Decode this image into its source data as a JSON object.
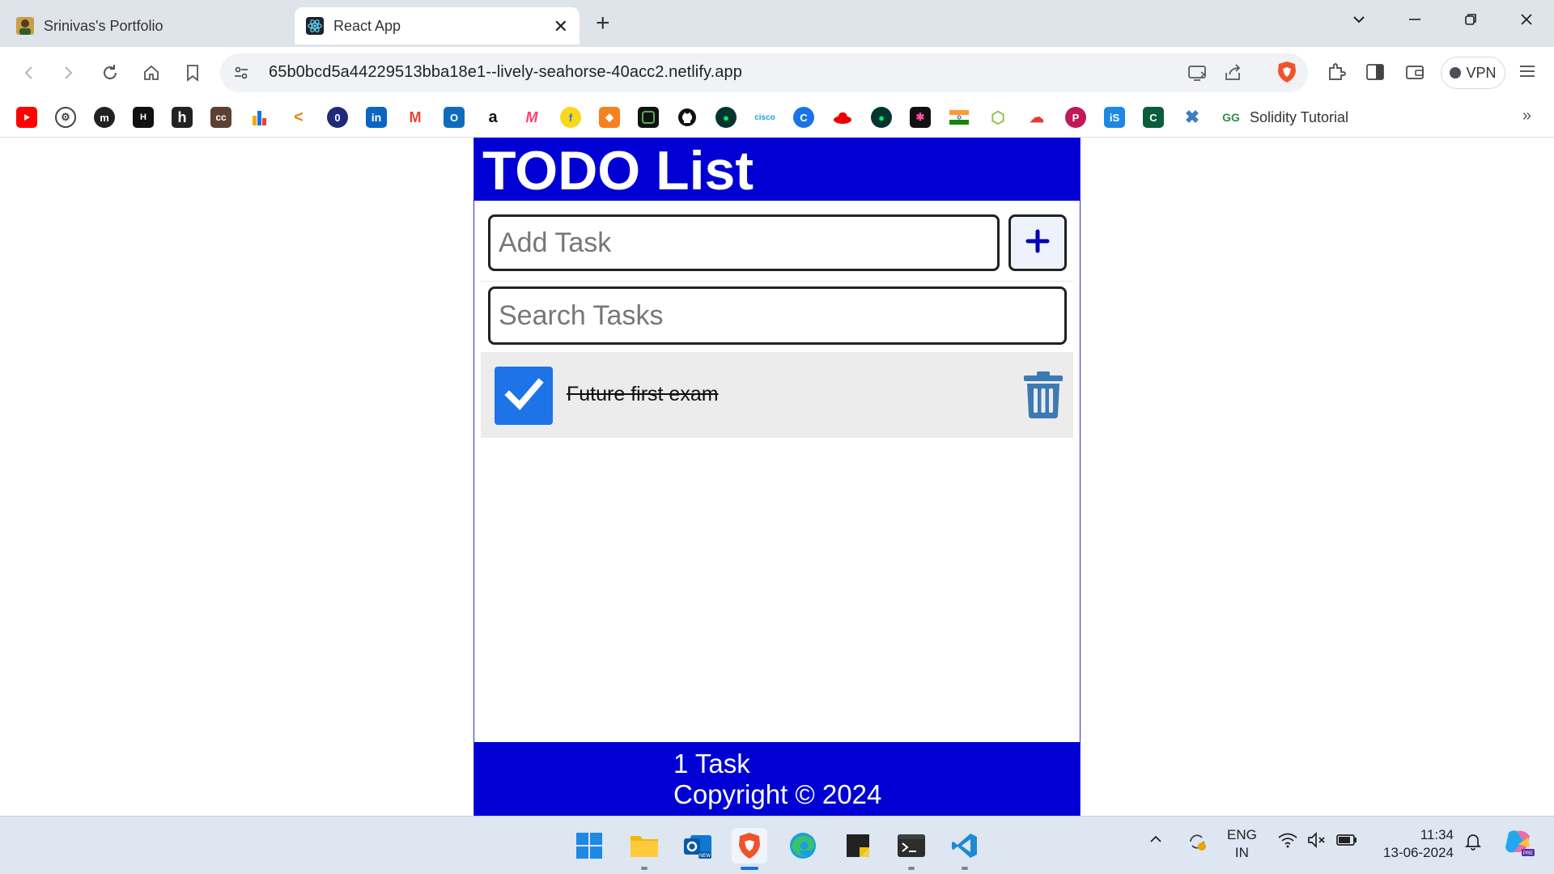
{
  "browser": {
    "tabs": [
      {
        "title": "Srinivas's Portfolio",
        "active": false
      },
      {
        "title": "React App",
        "active": true
      }
    ],
    "url": "65b0bcd5a44229513bba18e1--lively-seahorse-40acc2.netlify.app",
    "vpn_label": "VPN",
    "bookmark_label": "Solidity Tutorial"
  },
  "app": {
    "title": "TODO List",
    "add_placeholder": "Add Task",
    "search_placeholder": "Search Tasks",
    "tasks": [
      {
        "label": "Future first exam",
        "checked": true
      }
    ],
    "footer_count": "1 Task",
    "footer_copyright": "Copyright © 2024"
  },
  "taskbar": {
    "lang_line1": "ENG",
    "lang_line2": "IN",
    "time": "11:34",
    "date": "13-06-2024"
  },
  "colors": {
    "header_blue": "#0000d4",
    "checkbox_blue": "#1e73e8",
    "trash_blue": "#3c7ab5"
  }
}
